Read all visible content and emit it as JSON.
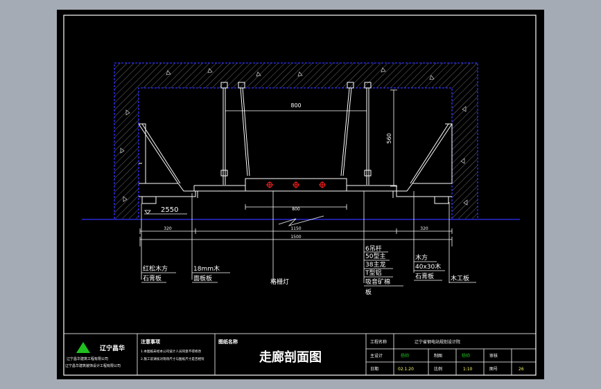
{
  "drawing": {
    "title": "走廊剖面图",
    "dimensions": {
      "width_800": "800",
      "height_560": "560",
      "level_2550": "2550",
      "sub_1": "800",
      "sub_2": "1150",
      "sub_3": "1500",
      "side_left": "320",
      "side_right": "320"
    },
    "labels": {
      "l1": "红松木方",
      "l2": "石膏板",
      "l3": "18mm木",
      "l4": "面板板",
      "l5": "格栅灯",
      "l6a": "6吊杆",
      "l6b": "50型主",
      "l6c": "38主龙",
      "l6d": "T型铝",
      "l6e": "吸音矿棉",
      "l6f": "板",
      "l7": "木方",
      "l8": "40x30木",
      "l9": "石膏板",
      "l10": "木工板"
    }
  },
  "title_block": {
    "company_logo_text": "辽宁昌华",
    "company_line1": "辽宁昌华建筑工程有限公司",
    "company_line2": "辽宁昌华建筑装饰设计工程有限公司",
    "notes_title": "注意事项",
    "note1": "1.本图纸未经本公司设计人员同意不得修改",
    "note2": "2.施工前请核对现场尺寸与图纸尺寸是否相符",
    "drawing_name_label": "图纸名称",
    "drawing_name": "走廊剖面图",
    "project_label": "工程名称",
    "project_value": "辽宁省钢电站规划设计院",
    "designer_label": "主设计",
    "designer_value": "杨帅",
    "drafter_label": "制图",
    "drafter_value": "杨帅",
    "check_label": "审核",
    "date_label": "日期",
    "date_value": "02.1.20",
    "scale_label": "比例",
    "scale_value": "1:10",
    "sheet_label": "图号",
    "sheet_value": "26"
  },
  "colors": {
    "background": "#a4abb4",
    "sheet": "#000000",
    "wall": "#3232ff",
    "line": "#ffffff",
    "accent_red": "#ff2020",
    "accent_green": "#20c020",
    "accent_yellow": "#ffff66"
  }
}
